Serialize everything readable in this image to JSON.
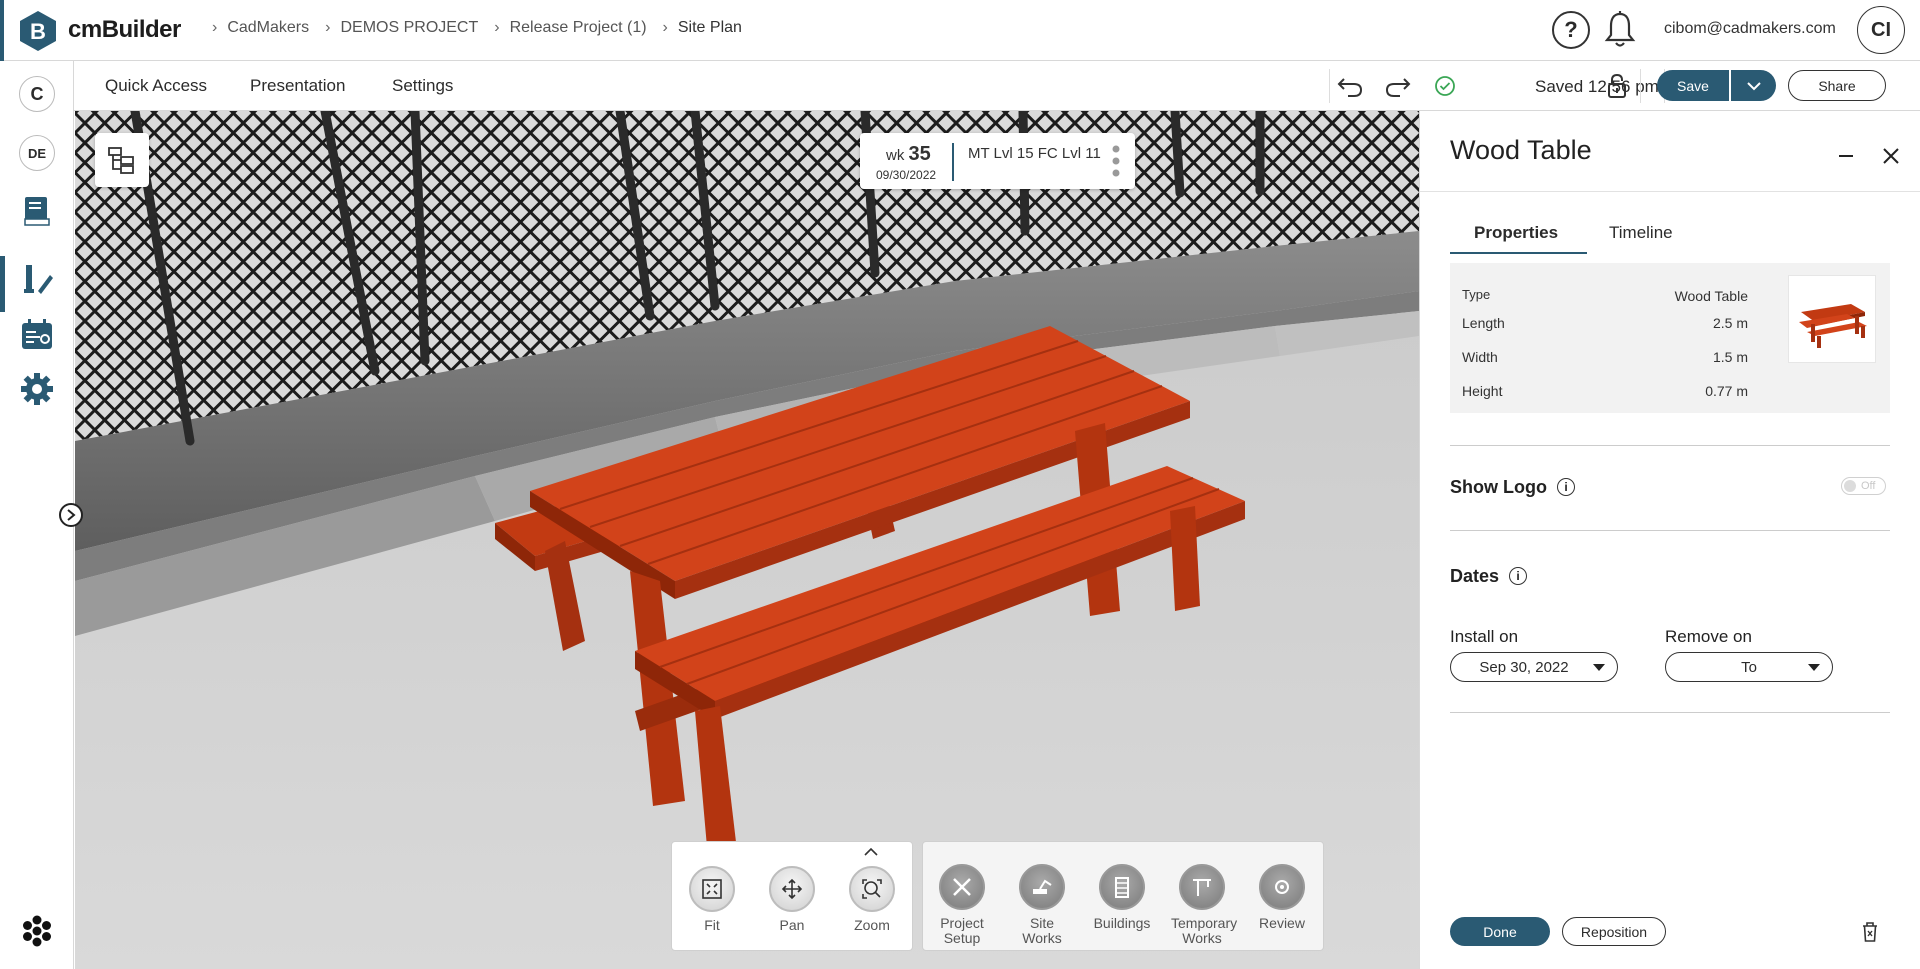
{
  "app": {
    "brand": "cmBuilder",
    "user_email": "cibom@cadmakers.com",
    "user_initials": "CI"
  },
  "breadcrumb": [
    "CadMakers",
    "DEMOS PROJECT",
    "Release Project (1)",
    "Site Plan"
  ],
  "left_rail": {
    "badge_top": "C",
    "badge_lang": "DE"
  },
  "menu": {
    "items": [
      "Quick Access",
      "Presentation",
      "Settings"
    ],
    "saved_text": "Saved 12:56 pm",
    "save_label": "Save",
    "share_label": "Share"
  },
  "viewport": {
    "week_prefix": "wk",
    "week_number": "35",
    "week_date": "09/30/2022",
    "level_text": "MT Lvl 15 FC Lvl 11"
  },
  "nav_tools": [
    {
      "label": "Fit",
      "icon": "fit-icon"
    },
    {
      "label": "Pan",
      "icon": "pan-icon"
    },
    {
      "label": "Zoom",
      "icon": "zoom-icon"
    }
  ],
  "category_tools": [
    {
      "label": "Project Setup",
      "icon": "tools-icon"
    },
    {
      "label": "Site Works",
      "icon": "excavator-icon"
    },
    {
      "label": "Buildings",
      "icon": "building-icon"
    },
    {
      "label": "Temporary Works",
      "icon": "crane-icon"
    },
    {
      "label": "Review",
      "icon": "review-icon"
    }
  ],
  "panel": {
    "title": "Wood Table",
    "tabs": [
      "Properties",
      "Timeline"
    ],
    "properties": [
      {
        "label": "Type",
        "value": "Wood Table"
      },
      {
        "label": "Length",
        "value": "2.5 m"
      },
      {
        "label": "Width",
        "value": "1.5 m"
      },
      {
        "label": "Height",
        "value": "0.77 m"
      }
    ],
    "show_logo_label": "Show Logo",
    "show_logo_state": "Off",
    "dates_label": "Dates",
    "install_label": "Install on",
    "install_value": "Sep 30, 2022",
    "remove_label": "Remove on",
    "remove_value": "To",
    "done_label": "Done",
    "reposition_label": "Reposition"
  },
  "colors": {
    "accent": "#2a5a73",
    "table_red": "#c23a12",
    "saved_green": "#3aa655"
  }
}
